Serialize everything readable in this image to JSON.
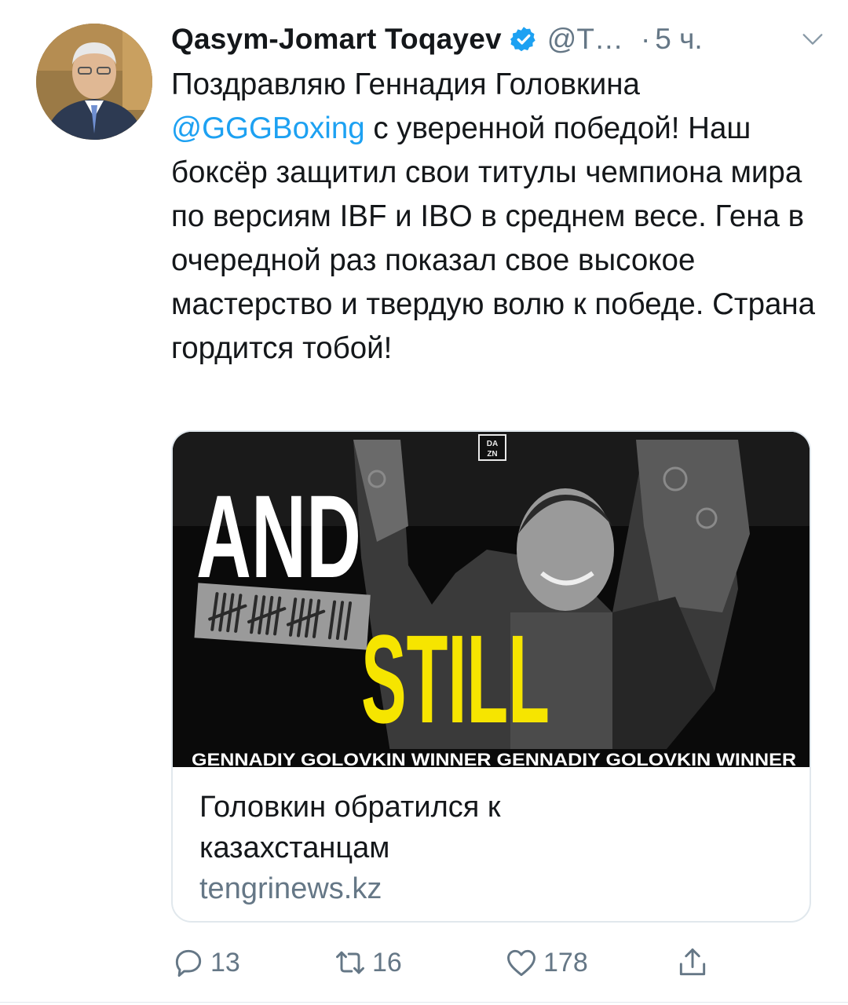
{
  "author": {
    "name": "Qasym-Jomart Toqayev",
    "handle": "@T…",
    "separator": "·",
    "time": "5 ч.",
    "verified_icon": "verified-badge-icon",
    "caret_icon": "chevron-down-icon"
  },
  "tweet": {
    "line1": "Поздравляю Геннадия Головкина",
    "mention": "@GGGBoxing",
    "line2_rest": " с уверенной победой!",
    "body": "Наш боксёр защитил свои титулы чемпиона мира по версиям IBF и IBO в среднем весе. Гена в очередной раз показал свое высокое мастерство и твердую волю к победе. Страна гордится тобой!"
  },
  "card": {
    "image": {
      "top_text": "AND",
      "bottom_text": "STILL",
      "logo": "DAZN",
      "ticker": "GENNADIY GOLOVKIN  WINNER  GENNADIY GOLOVKIN  WINNER"
    },
    "title": "Головкин обратился к казахстанцам",
    "domain": "tengrinews.kz"
  },
  "actions": {
    "reply": {
      "icon": "reply-icon",
      "count": "13"
    },
    "retweet": {
      "icon": "retweet-icon",
      "count": "16"
    },
    "like": {
      "icon": "heart-icon",
      "count": "178"
    },
    "share": {
      "icon": "share-icon"
    }
  },
  "colors": {
    "accent": "#1da1f2",
    "text": "#14171a",
    "secondary": "#657786",
    "border": "#e1e8ed",
    "highlight_yellow": "#f6e500"
  }
}
